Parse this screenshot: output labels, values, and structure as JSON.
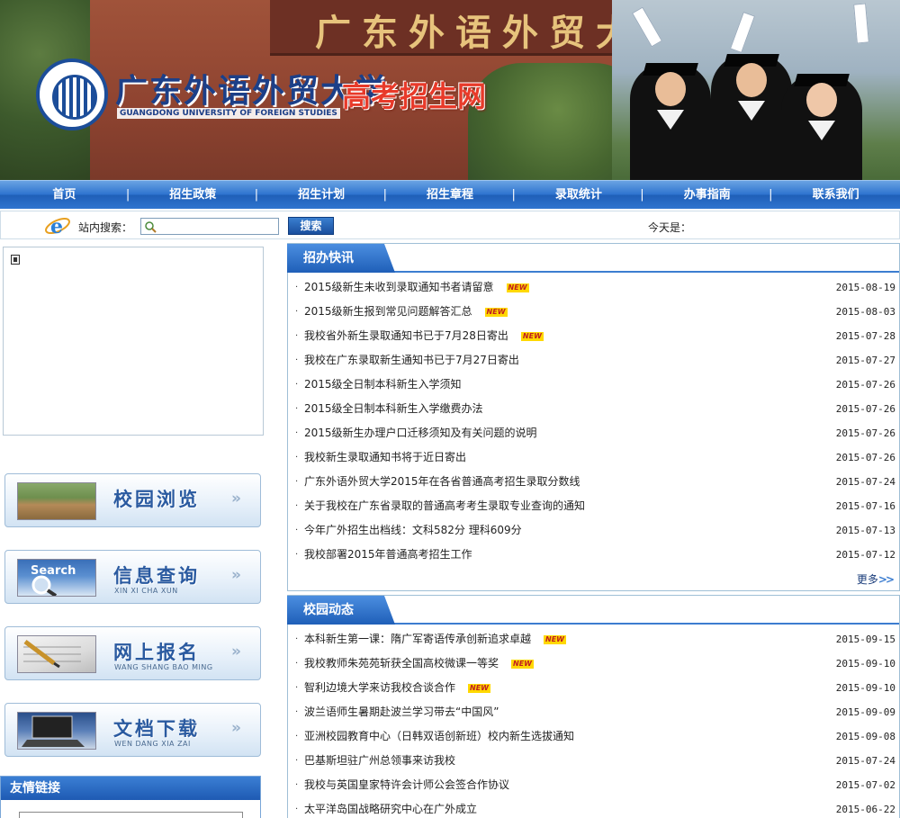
{
  "banner": {
    "gate_name": "广东外语外贸大学",
    "university_cn": "广东外语外贸大学",
    "university_en": "GUANGDONG UNIVERSITY OF FOREIGN STUDIES",
    "site_title": "高考招生网"
  },
  "nav": {
    "items": [
      "首页",
      "招生政策",
      "招生计划",
      "招生章程",
      "录取统计",
      "办事指南",
      "联系我们"
    ]
  },
  "search": {
    "label": "站内搜索：",
    "button": "搜索",
    "today_label": "今天是："
  },
  "promos": [
    {
      "title": "校园浏览",
      "sub": ""
    },
    {
      "title": "信息查询",
      "sub": "XIN XI CHA XUN"
    },
    {
      "title": "网上报名",
      "sub": "WANG SHANG BAO MING"
    },
    {
      "title": "文档下载",
      "sub": "WEN DANG XIA ZAI"
    }
  ],
  "promo_arrow": "»",
  "links_box": {
    "title": "友情链接"
  },
  "news": {
    "title": "招办快讯",
    "more": "更多",
    "new_badge": "NEW",
    "items": [
      {
        "title": "2015级新生未收到录取通知书者请留意",
        "date": "2015-08-19",
        "is_new": true
      },
      {
        "title": "2015级新生报到常见问题解答汇总",
        "date": "2015-08-03",
        "is_new": true
      },
      {
        "title": "我校省外新生录取通知书已于7月28日寄出",
        "date": "2015-07-28",
        "is_new": true
      },
      {
        "title": "我校在广东录取新生通知书已于7月27日寄出",
        "date": "2015-07-27",
        "is_new": false
      },
      {
        "title": "2015级全日制本科新生入学须知",
        "date": "2015-07-26",
        "is_new": false
      },
      {
        "title": "2015级全日制本科新生入学缴费办法",
        "date": "2015-07-26",
        "is_new": false
      },
      {
        "title": "2015级新生办理户口迁移须知及有关问题的说明",
        "date": "2015-07-26",
        "is_new": false
      },
      {
        "title": "我校新生录取通知书将于近日寄出",
        "date": "2015-07-26",
        "is_new": false
      },
      {
        "title": "广东外语外贸大学2015年在各省普通高考招生录取分数线",
        "date": "2015-07-24",
        "is_new": false
      },
      {
        "title": "关于我校在广东省录取的普通高考考生录取专业查询的通知",
        "date": "2015-07-16",
        "is_new": false
      },
      {
        "title": "今年广外招生出档线：文科582分  理科609分",
        "date": "2015-07-13",
        "is_new": false
      },
      {
        "title": "我校部署2015年普通高考招生工作",
        "date": "2015-07-12",
        "is_new": false
      }
    ]
  },
  "campus": {
    "title": "校园动态",
    "items": [
      {
        "title": "本科新生第一课：隋广军寄语传承创新追求卓越",
        "date": "2015-09-15",
        "is_new": true
      },
      {
        "title": "我校教师朱苑苑斩获全国高校微课一等奖",
        "date": "2015-09-10",
        "is_new": true
      },
      {
        "title": "智利边境大学来访我校合谈合作",
        "date": "2015-09-10",
        "is_new": true
      },
      {
        "title": "波兰语师生暑期赴波兰学习带去“中国风”",
        "date": "2015-09-09",
        "is_new": false
      },
      {
        "title": "亚洲校园教育中心（日韩双语创新班）校内新生选拔通知",
        "date": "2015-09-08",
        "is_new": false
      },
      {
        "title": "巴基斯坦驻广州总领事来访我校",
        "date": "2015-07-24",
        "is_new": false
      },
      {
        "title": "我校与英国皇家特许会计师公会签合作协议",
        "date": "2015-07-02",
        "is_new": false
      },
      {
        "title": "太平洋岛国战略研究中心在广外成立",
        "date": "2015-06-22",
        "is_new": false
      }
    ]
  }
}
